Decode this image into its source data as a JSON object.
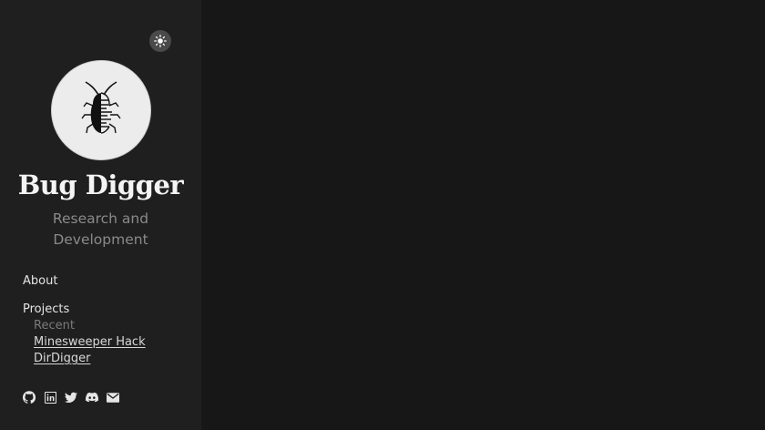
{
  "site": {
    "title": "Bug Digger",
    "tagline": "Research and Development"
  },
  "theme_toggle": {
    "icon": "sun-icon"
  },
  "nav": {
    "about": "About",
    "projects": "Projects",
    "recent_heading": "Recent",
    "recent_items": [
      "Minesweeper Hack",
      "DirDigger"
    ]
  },
  "social": [
    "github-icon",
    "linkedin-icon",
    "twitter-icon",
    "discord-icon",
    "email-icon"
  ],
  "colors": {
    "sidebar_bg": "#1f1f1f",
    "main_bg": "#171717",
    "title": "#f4f4f4",
    "tagline": "#8a8a8a"
  }
}
